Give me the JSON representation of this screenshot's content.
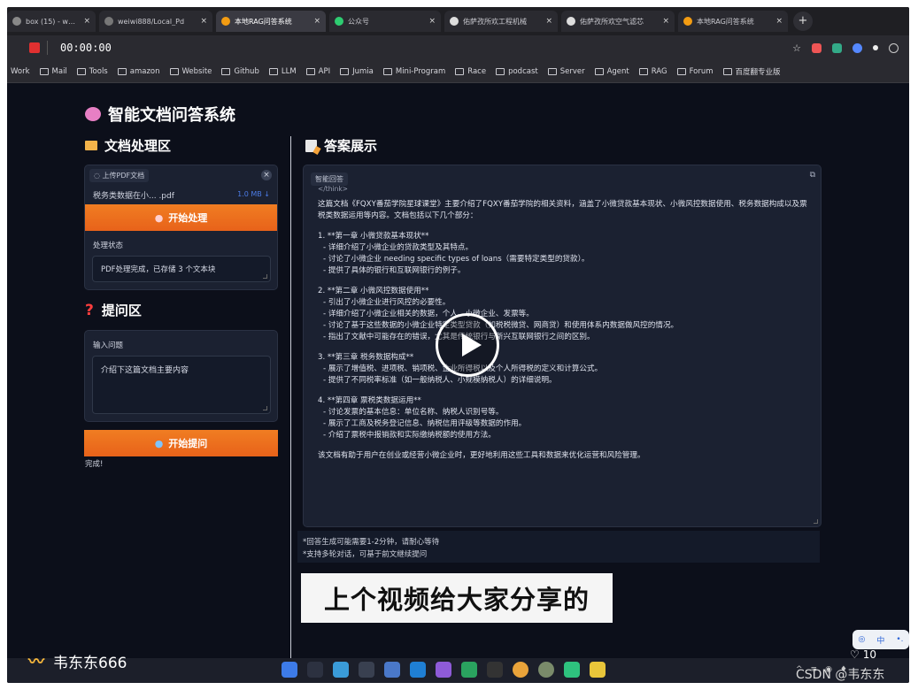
{
  "browser": {
    "tabs": [
      {
        "label": "box (15) - weiwi",
        "color": "#888"
      },
      {
        "label": "weiwi888/Local_Pd",
        "color": "#777"
      },
      {
        "label": "本地RAG问答系统",
        "color": "#f39c12",
        "active": true
      },
      {
        "label": "公众号",
        "color": "#2ecc71"
      },
      {
        "label": "佑萨孜所欢工程机械",
        "color": "#ddd"
      },
      {
        "label": "佑萨孜所欢空气滤芯",
        "color": "#ddd"
      },
      {
        "label": "本地RAG问答系统",
        "color": "#f39c12"
      }
    ],
    "new_tab_symbol": "+",
    "tab_close_symbol": "×",
    "timer": "00:00:00",
    "bookmarks": [
      "Work",
      "Mail",
      "Tools",
      "amazon",
      "Website",
      "Github",
      "LLM",
      "API",
      "Jumia",
      "Mini-Program",
      "Race",
      "podcast",
      "Server",
      "Agent",
      "RAG",
      "Forum",
      "百度翻专业版"
    ],
    "star_symbol": "☆"
  },
  "app": {
    "title": "智能文档问答系统",
    "doc_section_title": "文档处理区",
    "upload_label": "上传PDF文档",
    "file_name": "税务类数据在小... .pdf",
    "file_size": "1.0 MB ↓",
    "upload_close": "×",
    "process_button": "开始处理",
    "status_label": "处理状态",
    "status_text": "PDF处理完成，已存储 3 个文本块",
    "question_section_title": "提问区",
    "input_label": "输入问题",
    "input_value": "介绍下这篇文档主要内容",
    "ask_button": "开始提问",
    "done_text": "完成!",
    "answer_section_title": "答案展示",
    "answer_label": "智能回答",
    "answer_first_line": "</think>",
    "answer_intro": "这篇文档《FQXY番茄学院星球课堂》主要介绍了FQXY番茄学院的相关资料，涵盖了小微贷款基本现状、小微风控数据使用、税务数据构成以及票税类数据运用等内容。文档包括以下几个部分：",
    "chapters": [
      {
        "title": "1. **第一章 小微贷款基本现状**",
        "points": [
          "- 详细介绍了小微企业的贷款类型及其特点。",
          "- 讨论了小微企业 needing specific types of loans（需要特定类型的贷款）。",
          "- 提供了具体的银行和互联网银行的例子。"
        ]
      },
      {
        "title": "2. **第二章 小微风控数据使用**",
        "points": [
          "- 引出了小微企业进行风控的必要性。",
          "- 详细介绍了小微企业相关的数据，个人、小微企业、发票等。",
          "- 讨论了基于这些数据的小微企业特定类型贷款（如税税微贷、网商贷）和使用体系内数据做风控的情况。",
          "- 指出了文献中可能存在的错误，尤其是传统银行与新兴互联网银行之间的区别。"
        ]
      },
      {
        "title": "3. **第三章 税务数据构成**",
        "points": [
          "- 展示了增值税、进项税、销项税、企业所得税以及个人所得税的定义和计算公式。",
          "- 提供了不同税率标准（如一般纳税人、小规模纳税人）的详细说明。"
        ]
      },
      {
        "title": "4. **第四章 票税类数据运用**",
        "points": [
          "- 讨论发票的基本信息：单位名称、纳税人识别号等。",
          "- 展示了工商及税务登记信息、纳税信用评级等数据的作用。",
          "- 介绍了票税中报销款和实际缴纳税额的使用方法。"
        ]
      }
    ],
    "answer_conclusion": "该文档有助于用户在创业或经营小微企业时，更好地利用这些工具和数据来优化运营和风险管理。",
    "note_1": "*回答生成可能需要1-2分钟，请耐心等待",
    "note_2": "*支持多轮对话，可基于前文继续提问"
  },
  "video": {
    "subtitle": "上个视频给大家分享的"
  },
  "overlay": {
    "author": "韦东东666",
    "likes": "10",
    "watermark": "CSDN @韦东东",
    "corner_text": "中"
  }
}
